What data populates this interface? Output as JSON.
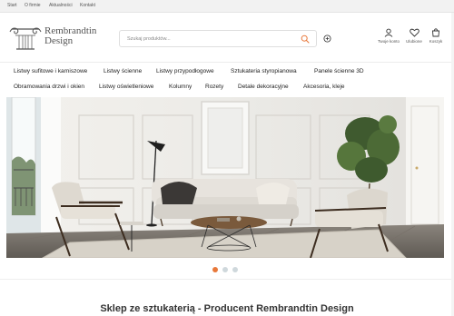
{
  "topbar": {
    "links": [
      "Start",
      "O firmie",
      "Aktualności",
      "Kontakt"
    ]
  },
  "logo": {
    "line1": "Rembrandtin",
    "line2": "Design"
  },
  "search": {
    "placeholder": "Szukaj produktów..."
  },
  "header_icons": {
    "account": "Twoje konto",
    "favorites": "Ulubione",
    "cart": "Koszyk"
  },
  "nav": {
    "row1": [
      "Listwy sufitowe i karniszowe",
      "Listwy ścienne",
      "Listwy przypodłogowe",
      "Sztukateria styropianowa",
      "Panele ścienne 3D"
    ],
    "row2": [
      "Obramowania drzwi i okien",
      "Listwy oświetleniowe",
      "Kolumny",
      "Rozety",
      "Detale dekoracyjne",
      "Akcesoria, kleje"
    ]
  },
  "slider": {
    "count": 3,
    "active": 1
  },
  "page": {
    "title": "Sklep ze sztukaterią - Producent Rembrandtin Design"
  },
  "colors": {
    "accent": "#e8783a",
    "text": "#222222",
    "muted": "#555555"
  },
  "icons": [
    "search-icon",
    "circle-plus-icon",
    "user-icon",
    "heart-icon",
    "cart-icon",
    "logo-capital-icon"
  ]
}
